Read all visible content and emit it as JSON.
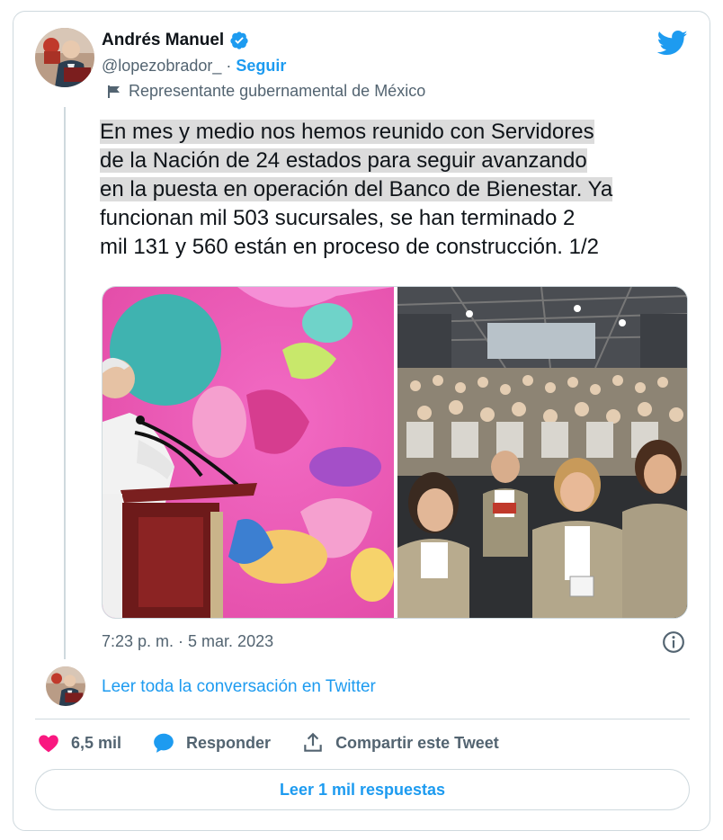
{
  "author": {
    "name": "Andrés Manuel",
    "handle": "@lopezobrador_",
    "separator": "·",
    "follow_label": "Seguir",
    "account_label": "Representante gubernamental de México"
  },
  "tweet": {
    "text_lines": [
      "En mes y medio nos hemos reunido con Servidores",
      "de la Nación de 24 estados para seguir avanzando",
      "en la puesta en operación del Banco de Bienestar. Ya",
      "funcionan mil 503 sucursales, se han terminado 2",
      "mil 131 y 560 están en proceso de construcción. 1/2"
    ],
    "timestamp": "7:23 p. m. · 5 mar. 2023"
  },
  "conversation_link": "Leer toda la conversación en Twitter",
  "actions": {
    "likes": "6,5 mil",
    "reply_label": "Responder",
    "share_label": "Compartir este Tweet"
  },
  "read_replies_label": "Leer 1 mil respuestas",
  "icons": {
    "verified": "verified-badge-icon",
    "flag": "flag-icon",
    "brand": "twitter-bird-icon",
    "info": "info-icon",
    "like": "heart-icon",
    "reply": "speech-bubble-icon",
    "share": "share-icon"
  },
  "colors": {
    "accent": "#1d9bf0",
    "like": "#f91880",
    "muted_text": "#536471",
    "border": "#cfd9de"
  }
}
